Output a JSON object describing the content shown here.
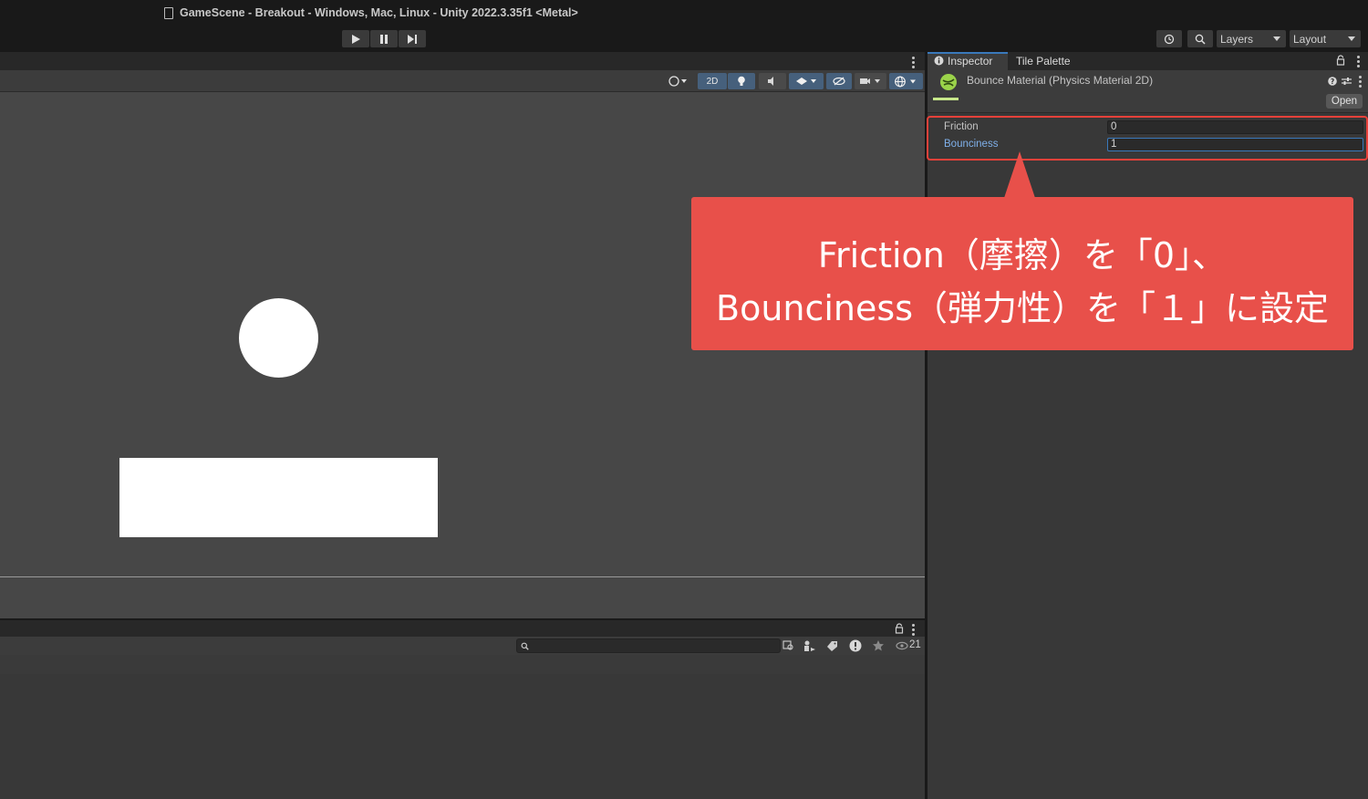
{
  "window": {
    "title": "GameScene - Breakout - Windows, Mac, Linux - Unity 2022.3.35f1 <Metal>"
  },
  "toolbar": {
    "play_icon": "play-icon",
    "pause_icon": "pause-icon",
    "step_icon": "step-icon",
    "history_icon": "history-icon",
    "search_icon": "search-icon",
    "layers_label": "Layers",
    "layout_label": "Layout"
  },
  "scene": {
    "toolbar": {
      "mode_2d_label": "2D"
    }
  },
  "project": {
    "hidden_count": "21"
  },
  "inspector": {
    "tabs": [
      "Inspector",
      "Tile Palette"
    ],
    "asset_name": "Bounce Material (Physics Material 2D)",
    "open_label": "Open",
    "fields": [
      {
        "label": "Friction",
        "value": "0"
      },
      {
        "label": "Bounciness",
        "value": "1"
      }
    ]
  },
  "callout": {
    "line1": "Friction（摩擦）を「0」、",
    "line2": "Bounciness（弾力性）を「１」に設定",
    "color": "#e8504a"
  },
  "colors": {
    "highlight": "#e8413a",
    "accent_blue": "#3a79bb",
    "material_green": "#9bd34a"
  }
}
